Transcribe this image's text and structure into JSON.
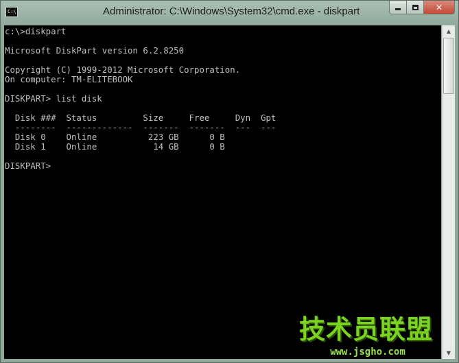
{
  "window": {
    "title": "Administrator: C:\\Windows\\System32\\cmd.exe - diskpart",
    "icon": "cmd-console-icon",
    "icon_text": "C:\\",
    "controls": {
      "minimize_icon": "minimize-icon",
      "maximize_icon": "maximize-icon",
      "close_icon": "close-icon",
      "close_glyph": "✕"
    }
  },
  "console": {
    "lines": [
      "c:\\>diskpart",
      "",
      "Microsoft DiskPart version 6.2.8250",
      "",
      "Copyright (C) 1999-2012 Microsoft Corporation.",
      "On computer: TM-ELITEBOOK",
      "",
      "DISKPART> list disk",
      "",
      "  Disk ###  Status         Size     Free     Dyn  Gpt",
      "  --------  -------------  -------  -------  ---  ---",
      "  Disk 0    Online          223 GB      0 B",
      "  Disk 1    Online           14 GB      0 B",
      "",
      "DISKPART>"
    ],
    "text_color": "#c0c0c0",
    "background": "#000000"
  },
  "scrollbar": {
    "up_arrow": "▲",
    "down_arrow": "▼"
  },
  "watermark": {
    "logo_text": "技术员联盟",
    "url": "www.jsgho.com",
    "color": "#7bd321"
  }
}
